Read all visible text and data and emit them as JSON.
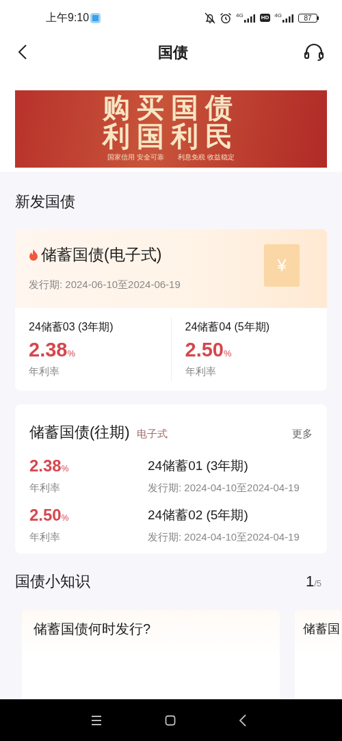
{
  "status_bar": {
    "time": "上午9:10",
    "network_1": "4G",
    "hd": "HD",
    "network_2": "4G",
    "battery": "87"
  },
  "nav": {
    "title": "国债"
  },
  "banner": {
    "headline": [
      "购买国债",
      "利国利民"
    ],
    "taglines": [
      "国家信用 安全可靠",
      "利息免税 收益稳定"
    ]
  },
  "new_issue": {
    "heading": "新发国债",
    "card": {
      "title": "储蓄国债(电子式)",
      "hot": true,
      "period": "发行期: 2024-06-10至2024-06-19",
      "ticket_symbol": "¥",
      "products": [
        {
          "name": "24储蓄03 (3年期)",
          "rate": "2.38",
          "unit": "%",
          "rate_label": "年利率"
        },
        {
          "name": "24储蓄04 (5年期)",
          "rate": "2.50",
          "unit": "%",
          "rate_label": "年利率"
        }
      ]
    }
  },
  "past": {
    "title": "储蓄国债(往期)",
    "tag": "电子式",
    "more": "更多",
    "rows": [
      {
        "rate": "2.38",
        "unit": "%",
        "rate_label": "年利率",
        "name": "24储蓄01 (3年期)",
        "period": "发行期: 2024-04-10至2024-04-19"
      },
      {
        "rate": "2.50",
        "unit": "%",
        "rate_label": "年利率",
        "name": "24储蓄02 (5年期)",
        "period": "发行期: 2024-04-10至2024-04-19"
      }
    ]
  },
  "knowledge": {
    "heading": "国债小知识",
    "page": "1",
    "total": "/5",
    "cards": [
      {
        "question": "储蓄国债何时发行?"
      },
      {
        "question": "储蓄国"
      }
    ]
  }
}
